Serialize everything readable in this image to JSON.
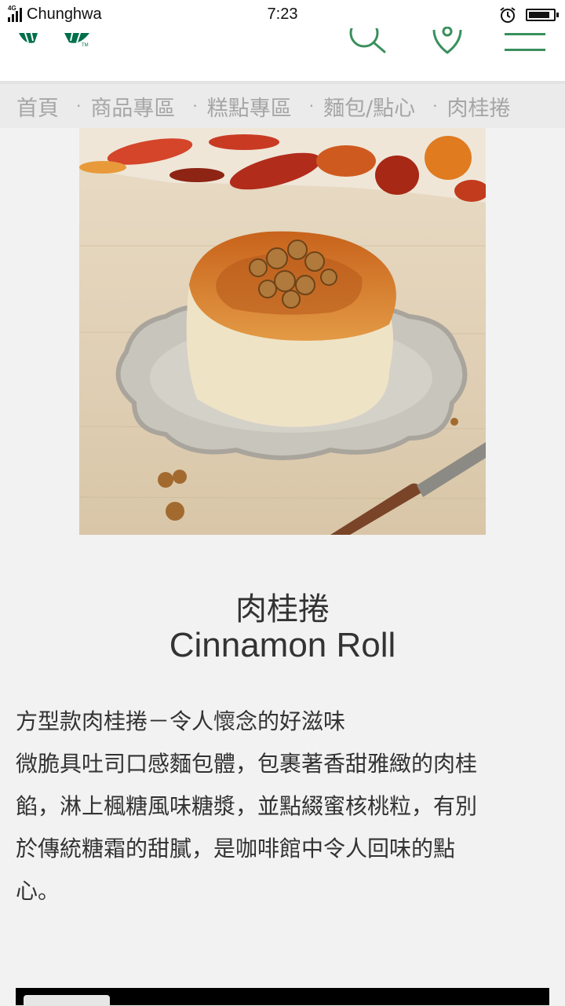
{
  "status_bar": {
    "network": "4G",
    "carrier": "Chunghwa",
    "time": "7:23"
  },
  "header": {
    "brand_color": "#00704a",
    "accent_color": "#3a8f5c",
    "icons": [
      "starbucks-logo-icon",
      "search-icon",
      "location-pin-icon",
      "hamburger-menu-icon"
    ]
  },
  "breadcrumb": {
    "items": [
      {
        "label": "首頁"
      },
      {
        "label": "商品專區"
      },
      {
        "label": "糕點專區"
      },
      {
        "label": "麵包/點心"
      },
      {
        "label": "肉桂捲"
      }
    ],
    "separator": "·"
  },
  "product": {
    "name_zh": "肉桂捲",
    "name_en": "Cinnamon Roll",
    "description": [
      "方型款肉桂捲－令人懷念的好滋味",
      "微脆具吐司口感麵包體，包裹著香甜雅緻的肉桂",
      "餡，淋上楓糖風味糖漿，並點綴蜜核桃粒，有別",
      "於傳統糖霜的甜膩，是咖啡館中令人回味的點",
      "心。"
    ]
  }
}
